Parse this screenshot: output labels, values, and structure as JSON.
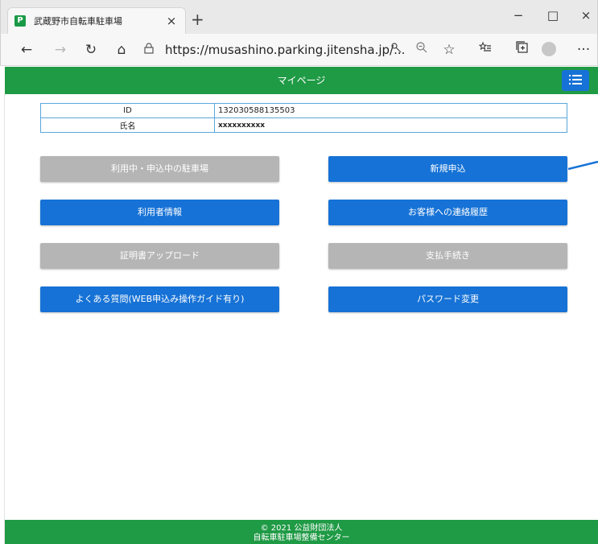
{
  "browser": {
    "tab_title": "武蔵野市自転車駐車場",
    "favicon_letter": "P",
    "tab_close": "×",
    "new_tab": "+",
    "minimize": "−",
    "maximize": "□",
    "close": "×",
    "url": "https://musashino.parking.jitensha.jp/...",
    "more": "···"
  },
  "header": {
    "title": "マイページ"
  },
  "info": {
    "rows": [
      {
        "label": "ID",
        "value": "132030588135503"
      },
      {
        "label": "氏名",
        "value": "xxxxxxxxxx"
      }
    ]
  },
  "buttons": {
    "parking_in_use": "利用中・申込中の駐車場",
    "new_application": "新規申込",
    "user_info": "利用者情報",
    "contact_history": "お客様への連絡履歴",
    "certificate_upload": "証明書アップロード",
    "payment": "支払手続き",
    "faq": "よくある質問(WEB申込み操作ガイド有り)",
    "change_password": "パスワード変更"
  },
  "footer": {
    "line1": "© 2021 公益財団法人",
    "line2": "自転車駐車場整備センター"
  },
  "colors": {
    "green": "#1f9a45",
    "blue": "#1672d6",
    "gray": "#b5b5b5"
  }
}
